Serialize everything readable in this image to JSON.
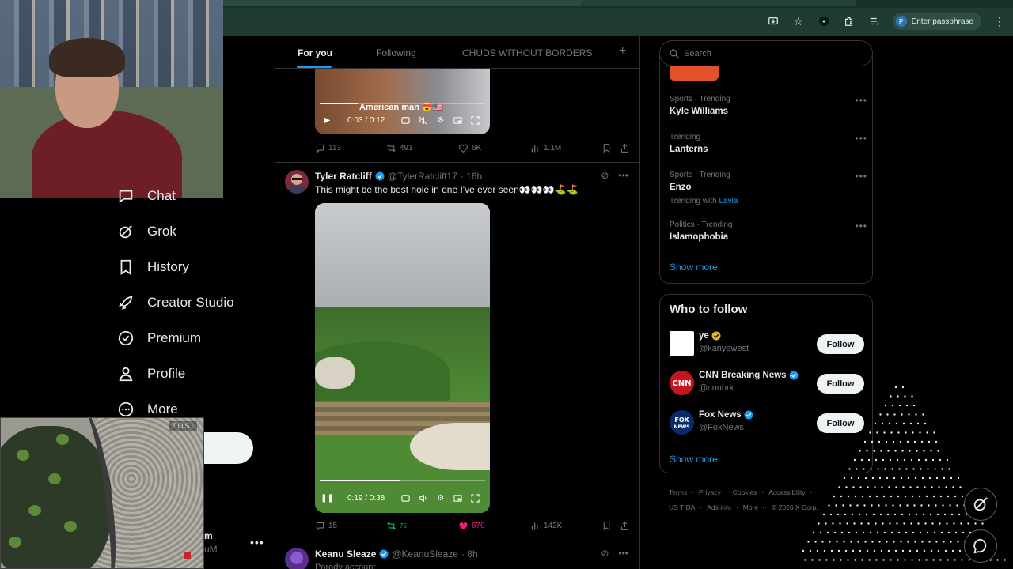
{
  "browser": {
    "passphrase_label": "Enter passphrase",
    "passphrase_avatar": "P"
  },
  "sidebar": {
    "items": [
      {
        "label": "Chat",
        "icon": "chat-icon"
      },
      {
        "label": "Grok",
        "icon": "grok-icon"
      },
      {
        "label": "History",
        "icon": "bookmark-icon"
      },
      {
        "label": "Creator Studio",
        "icon": "rocket-icon"
      },
      {
        "label": "Premium",
        "icon": "verified-badge-icon"
      },
      {
        "label": "Profile",
        "icon": "person-icon"
      },
      {
        "label": "More",
        "icon": "more-circle-icon"
      }
    ],
    "account_name_fragment": "m",
    "account_handle_fragment": "uM",
    "account_more": "•••"
  },
  "overlays": {
    "garden_cam_label": "ZOSI"
  },
  "timeline": {
    "tabs": [
      "For you",
      "Following",
      "CHUDS WITHOUT BORDERS"
    ],
    "add_tab": "+",
    "post1": {
      "video_caption": "American man 😍🇺🇸",
      "video_time": "0:03 / 0:12",
      "replies": "113",
      "reposts": "491",
      "likes": "6K",
      "views": "1.1M"
    },
    "post2": {
      "name": "Tyler Ratcliff",
      "handle": "@TylerRatcliff17",
      "time": "· 16h",
      "text": "This might be the best hole in one I've ever seen👀👀👀⛳️⛳️",
      "video_time": "0:19 / 0:38",
      "replies": "15",
      "reposts": "75",
      "likes": "670",
      "views": "142K"
    },
    "post3": {
      "name": "Keanu Sleaze",
      "handle": "@KeanuSleaze",
      "time": "· 8h",
      "text_fragment": "Parody account"
    }
  },
  "right": {
    "search_placeholder": "Search",
    "trends": [
      {
        "category": "Sports · Trending",
        "title": "Kyle Williams"
      },
      {
        "category": "Trending",
        "title": "Lanterns"
      },
      {
        "category": "Sports · Trending",
        "title": "Enzo",
        "with_label": "Trending with",
        "with_value": "Lavia"
      },
      {
        "category": "Politics · Trending",
        "title": "Islamophobia"
      }
    ],
    "show_more": "Show more",
    "who_to_follow": {
      "title": "Who to follow",
      "accounts": [
        {
          "name": "ye",
          "handle": "@kanyewest",
          "button": "Follow"
        },
        {
          "name": "CNN Breaking News",
          "handle": "@cnnbrk",
          "button": "Follow"
        },
        {
          "name": "Fox News",
          "handle": "@FoxNews",
          "button": "Follow"
        }
      ],
      "show_more": "Show more"
    },
    "footer": {
      "row1": [
        "Terms",
        "·",
        "Privacy",
        "·",
        "Cookies",
        "·",
        "Accessibility",
        "·"
      ],
      "row2": [
        "US TIDA",
        "·",
        "Ads info",
        "·",
        "More ···",
        "© 2026 X Corp."
      ]
    }
  },
  "colors": {
    "accent": "#1d9bf0",
    "like_active": "#f91880",
    "repost_active": "#00ba7c",
    "border": "#2f3336"
  }
}
